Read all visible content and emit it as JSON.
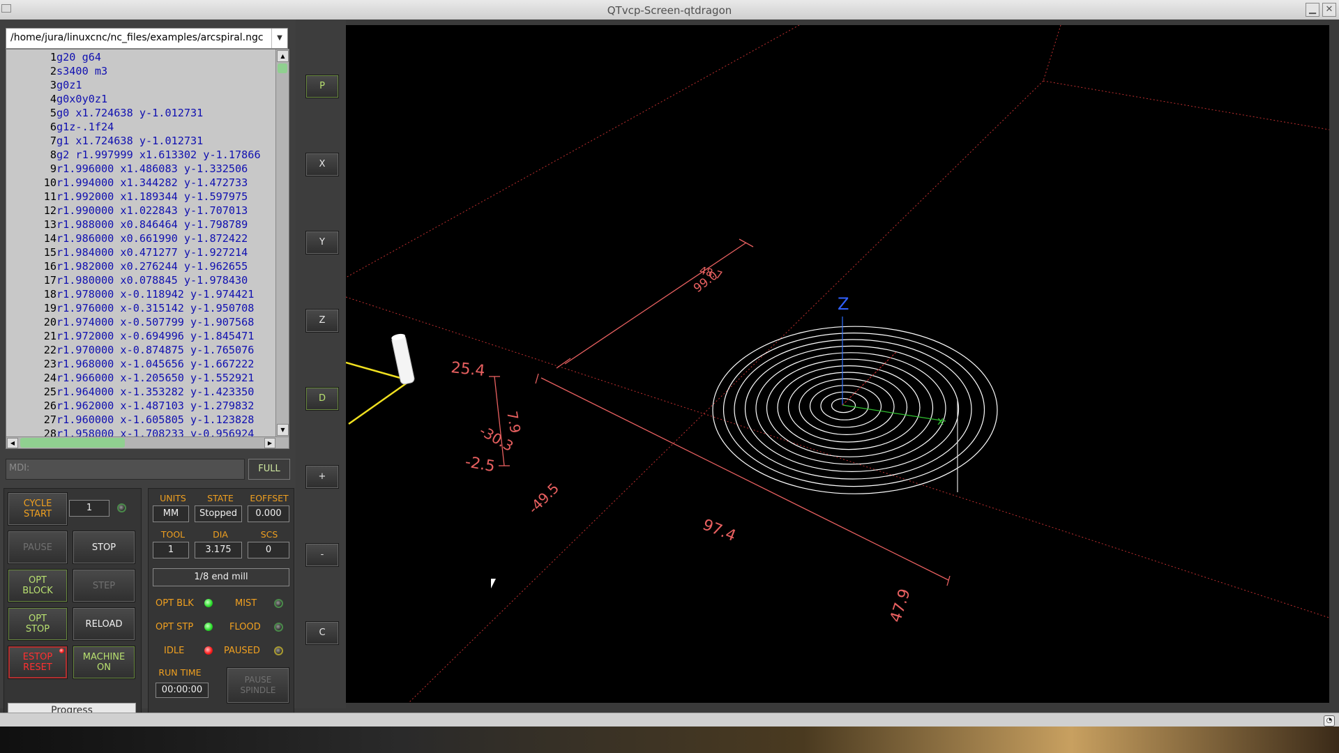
{
  "window": {
    "title": "QTvcp-Screen-qtdragon"
  },
  "file": {
    "path": "/home/jura/linuxcnc/nc_files/examples/arcspiral.ngc"
  },
  "gcode_lines": [
    {
      "n": "1",
      "code": "g20 g64"
    },
    {
      "n": "2",
      "code": "s3400 m3"
    },
    {
      "n": "3",
      "code": "g0z1"
    },
    {
      "n": "4",
      "code": "g0x0y0z1"
    },
    {
      "n": "5",
      "code": "g0 x1.724638 y-1.012731"
    },
    {
      "n": "6",
      "code": "g1z-.1f24"
    },
    {
      "n": "7",
      "code": "g1 x1.724638 y-1.012731"
    },
    {
      "n": "8",
      "code": "g2 r1.997999 x1.613302 y-1.17866"
    },
    {
      "n": "9",
      "code": "r1.996000 x1.486083 y-1.332506"
    },
    {
      "n": "10",
      "code": "r1.994000 x1.344282 y-1.472733"
    },
    {
      "n": "11",
      "code": "r1.992000 x1.189344 y-1.597975"
    },
    {
      "n": "12",
      "code": "r1.990000 x1.022843 y-1.707013"
    },
    {
      "n": "13",
      "code": "r1.988000 x0.846464 y-1.798789"
    },
    {
      "n": "14",
      "code": "r1.986000 x0.661990 y-1.872422"
    },
    {
      "n": "15",
      "code": "r1.984000 x0.471277 y-1.927214"
    },
    {
      "n": "16",
      "code": "r1.982000 x0.276244 y-1.962655"
    },
    {
      "n": "17",
      "code": "r1.980000 x0.078845 y-1.978430"
    },
    {
      "n": "18",
      "code": "r1.978000 x-0.118942 y-1.974421"
    },
    {
      "n": "19",
      "code": "r1.976000 x-0.315142 y-1.950708"
    },
    {
      "n": "20",
      "code": "r1.974000 x-0.507799 y-1.907568"
    },
    {
      "n": "21",
      "code": "r1.972000 x-0.694996 y-1.845471"
    },
    {
      "n": "22",
      "code": "r1.970000 x-0.874875 y-1.765076"
    },
    {
      "n": "23",
      "code": "r1.968000 x-1.045656 y-1.667222"
    },
    {
      "n": "24",
      "code": "r1.966000 x-1.205650 y-1.552921"
    },
    {
      "n": "25",
      "code": "r1.964000 x-1.353282 y-1.423350"
    },
    {
      "n": "26",
      "code": "r1.962000 x-1.487103 y-1.279832"
    },
    {
      "n": "27",
      "code": "r1.960000 x-1.605805 y-1.123828"
    },
    {
      "n": "28",
      "code": "r1.958000 x-1.708233 y-0.956924"
    }
  ],
  "mdi": {
    "placeholder": "MDI:",
    "full_label": "FULL"
  },
  "controls": {
    "cycle_start": "CYCLE\nSTART",
    "cycle_count": "1",
    "pause": "PAUSE",
    "stop": "STOP",
    "opt_block": "OPT\nBLOCK",
    "step": "STEP",
    "opt_stop": "OPT\nSTOP",
    "reload": "RELOAD",
    "estop": "ESTOP\nRESET",
    "machine_on": "MACHINE\nON",
    "progress": "Progress"
  },
  "info": {
    "units_label": "UNITS",
    "units": "MM",
    "state_label": "STATE",
    "state": "Stopped",
    "eoffset_label": "EOFFSET",
    "eoffset": "0.000",
    "tool_label": "TOOL",
    "tool": "1",
    "dia_label": "DIA",
    "dia": "3.175",
    "scs_label": "SCS",
    "scs": "0",
    "tool_desc": "1/8 end mill",
    "opt_blk": "OPT BLK",
    "mist": "MIST",
    "opt_stp": "OPT STP",
    "flood": "FLOOD",
    "idle": "IDLE",
    "paused": "PAUSED",
    "run_time_label": "RUN TIME",
    "run_time": "00:00:00",
    "pause_spindle": "PAUSE\nSPINDLE"
  },
  "view_buttons": [
    "P",
    "X",
    "Y",
    "Z",
    "D",
    "+",
    "-",
    "C"
  ],
  "viewport": {
    "dims": [
      "48.7",
      "99.0",
      "25.4",
      "7.9",
      "-30.3",
      "-2.5",
      "-49.5",
      "97.4",
      "47.9"
    ],
    "axis_z": "Z"
  },
  "colors": {
    "accent": "#f0a020",
    "ok_green": "#b8e070",
    "grid": "#ff4040",
    "toolpath": "#ffffff"
  }
}
